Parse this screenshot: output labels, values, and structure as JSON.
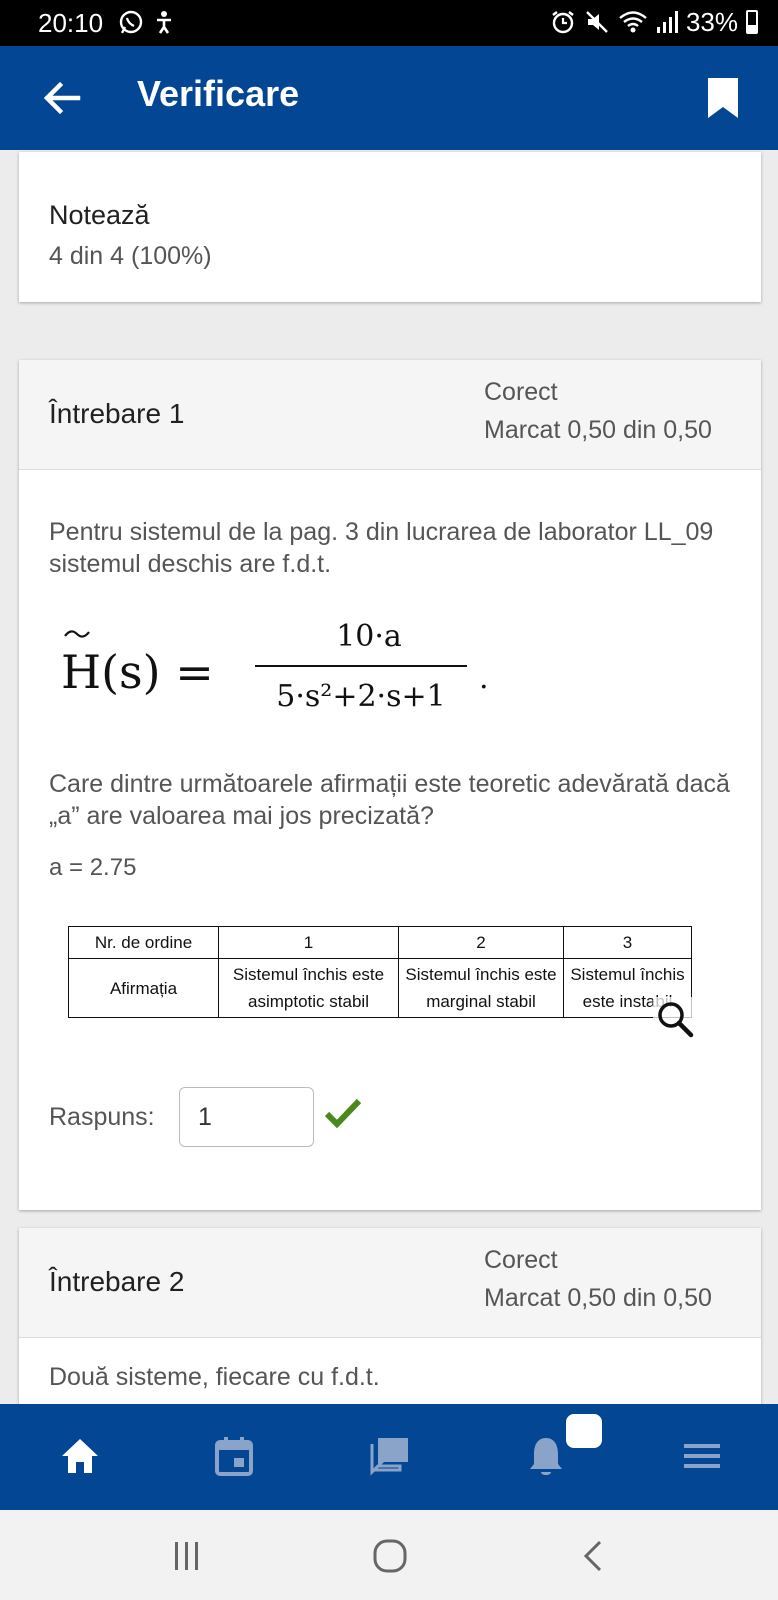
{
  "status_bar": {
    "time": "20:10",
    "battery": "33%",
    "icons": [
      "whatsapp-icon",
      "accessibility-icon",
      "alarm-icon",
      "mute-icon",
      "wifi-icon",
      "signal-icon",
      "battery-icon"
    ]
  },
  "app_bar": {
    "title": "Verificare",
    "back_icon": "arrow-back-icon",
    "bookmark_icon": "bookmark-icon"
  },
  "grade": {
    "label": "Notează",
    "value": "4 din 4 (100%)"
  },
  "questions": [
    {
      "title": "Întrebare 1",
      "status": "Corect",
      "mark": "Marcat 0,50 din 0,50",
      "text": "Pentru sistemul de la pag. 3 din lucrarea de laborator LL_09 sistemul deschis are f.d.t.",
      "formula": {
        "lhs": "H(s) =",
        "numerator": "10·a",
        "denominator": "5·s²+2·s+1",
        "trailing": "."
      },
      "text2": "Care dintre următoarele afirmații este teoretic adevărată dacă „a” are valoarea mai jos precizată?",
      "a_value": "a = 2.75",
      "table": {
        "header": [
          "Nr. de ordine",
          "1",
          "2",
          "3"
        ],
        "row_label": "Afirmația",
        "row": [
          "Sistemul închis este asimptotic stabil",
          "Sistemul închis este marginal stabil",
          "Sistemul închis este instabil"
        ]
      },
      "response_label": "Raspuns:",
      "response_value": "1",
      "result_icon": "checkmark-icon"
    },
    {
      "title": "Întrebare 2",
      "status": "Corect",
      "mark": "Marcat 0,50 din 0,50",
      "text": "Două sisteme, fiecare cu f.d.t."
    }
  ],
  "bottom_nav": {
    "items": [
      "home-icon",
      "calendar-icon",
      "messages-icon",
      "notifications-icon",
      "menu-icon"
    ],
    "accent": "#034694"
  },
  "system_nav": {
    "items": [
      "recents-icon",
      "home-circle-icon",
      "back-chevron-icon"
    ]
  }
}
